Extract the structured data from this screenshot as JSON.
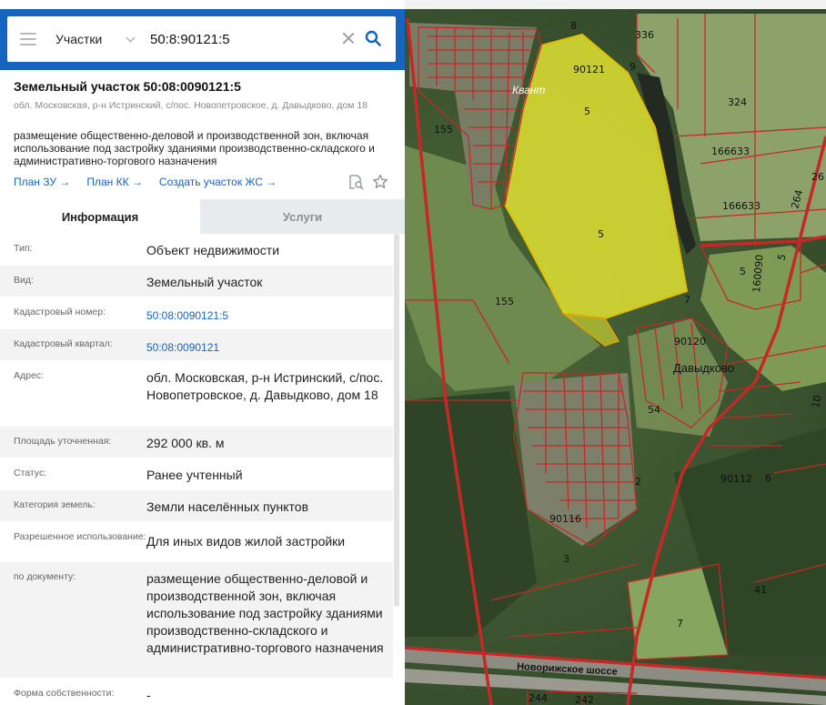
{
  "search": {
    "type_label": "Участки",
    "query": "50:8:90121:5"
  },
  "object": {
    "title": "Земельный участок 50:08:0090121:5",
    "address": "обл. Московская, р-н Истринский, с/пос. Новопетровское, д. Давыдково, дом 18",
    "description": "размещение общественно-деловой и производственной зон, включая использование под застройку зданиями производственно-складского и административно-торгового назначения"
  },
  "links": {
    "plan_zu": "План ЗУ →",
    "plan_kk": "План КК →",
    "create_zhs": "Создать участок ЖС →"
  },
  "tabs": {
    "info": "Информация",
    "services": "Услуги"
  },
  "details": [
    {
      "label": "Тип:",
      "value": "Объект недвижимости"
    },
    {
      "label": "Вид:",
      "value": "Земельный участок"
    },
    {
      "label": "Кадастровый номер:",
      "value": "50:08:0090121:5"
    },
    {
      "label": "Кадастровый квартал:",
      "value": "50:08:0090121"
    },
    {
      "label": "Адрес:",
      "value": "обл. Московская, р-н Истринский, с/пос. Новопетровское, д. Давыдково, дом 18"
    },
    {
      "label": "Площадь уточненная:",
      "value": "292 000 кв. м"
    },
    {
      "label": "Статус:",
      "value": "Ранее учтенный"
    },
    {
      "label": "Категория земель:",
      "value": "Земли населённых пунктов"
    },
    {
      "label": "Разрешенное использование:",
      "value": "Для иных видов жилой застройки"
    },
    {
      "label": "по документу:",
      "value": "размещение общественно-деловой и производственной зон, включая использование под застройку зданиями производственно-складского и административно-торгового назначения"
    },
    {
      "label": "Форма собственности:",
      "value": "-"
    }
  ],
  "map_labels": {
    "l8": "8",
    "l336": "336",
    "l90121": "90121",
    "l9": "9",
    "kvant": "Квант",
    "l5a": "5",
    "l324": "324",
    "l155a": "155",
    "l166633a": "166633",
    "l166633b": "166633",
    "l264": "264",
    "l26": "26",
    "l5b": "5",
    "l5c": "5",
    "l160090": "160090",
    "l5d": "5",
    "l155b": "155",
    "l7a": "7",
    "l90120": "90120",
    "davydkovo": "Давыдково",
    "l54": "54",
    "l10": "10",
    "l2": "2",
    "l90112": "90112",
    "l6": "6",
    "l90116": "90116",
    "l3": "3",
    "l41": "41",
    "l7b": "7",
    "highway": "Новорижское шоссе",
    "l244": "244",
    "l242": "242"
  },
  "colors": {
    "accent": "#1565c0",
    "parcel_border": "#c62828",
    "selected_fill": "#e6e832"
  }
}
